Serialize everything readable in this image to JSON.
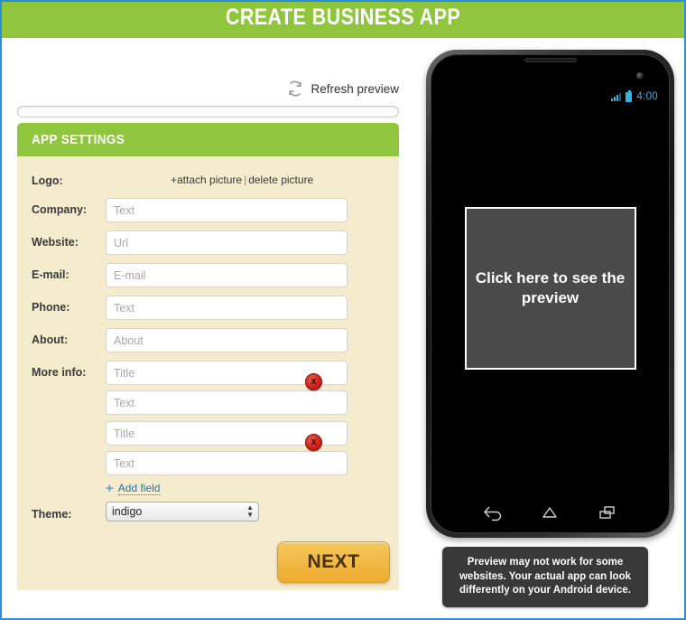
{
  "header": {
    "title": "CREATE BUSINESS APP"
  },
  "toolbar": {
    "refresh_label": "Refresh preview",
    "refresh_icon": "refresh-icon"
  },
  "progress": {
    "percent": 0
  },
  "settings": {
    "panel_title": "APP SETTINGS",
    "logo": {
      "label": "Logo:",
      "attach_label": "+attach picture",
      "separator": "|",
      "delete_label": "delete picture"
    },
    "fields": [
      {
        "label": "Company:",
        "placeholder": "Text",
        "value": ""
      },
      {
        "label": "Website:",
        "placeholder": "Url",
        "value": ""
      },
      {
        "label": "E-mail:",
        "placeholder": "E-mail",
        "value": ""
      },
      {
        "label": "Phone:",
        "placeholder": "Text",
        "value": ""
      },
      {
        "label": "About:",
        "placeholder": "About",
        "value": ""
      }
    ],
    "more_info": {
      "label": "More info:",
      "groups": [
        {
          "title_placeholder": "Title",
          "title_value": "",
          "text_placeholder": "Text",
          "text_value": "",
          "delete_glyph": "x"
        },
        {
          "title_placeholder": "Title",
          "title_value": "",
          "text_placeholder": "Text",
          "text_value": "",
          "delete_glyph": "x"
        }
      ]
    },
    "add_field": {
      "plus": "+",
      "label": "Add field"
    },
    "theme": {
      "label": "Theme:",
      "selected": "indigo",
      "options": [
        "indigo"
      ]
    },
    "next_button": "NEXT"
  },
  "phone": {
    "status": {
      "time": "4:00",
      "signal_icon": "signal-bars-icon",
      "battery_icon": "battery-icon"
    },
    "preview_placeholder": "Click here to see the preview",
    "nav": {
      "back": "back-icon",
      "home": "home-icon",
      "recents": "recents-icon"
    }
  },
  "tooltip": {
    "text": "Preview may not work for some websites. Your actual app can look differently on your Android device."
  },
  "colors": {
    "green": "#8fc63d",
    "cream": "#f4eccc",
    "orange": "#eeab2e",
    "red": "#cf2016",
    "android_blue": "#33b5e5",
    "link_blue": "#2f6fae"
  }
}
